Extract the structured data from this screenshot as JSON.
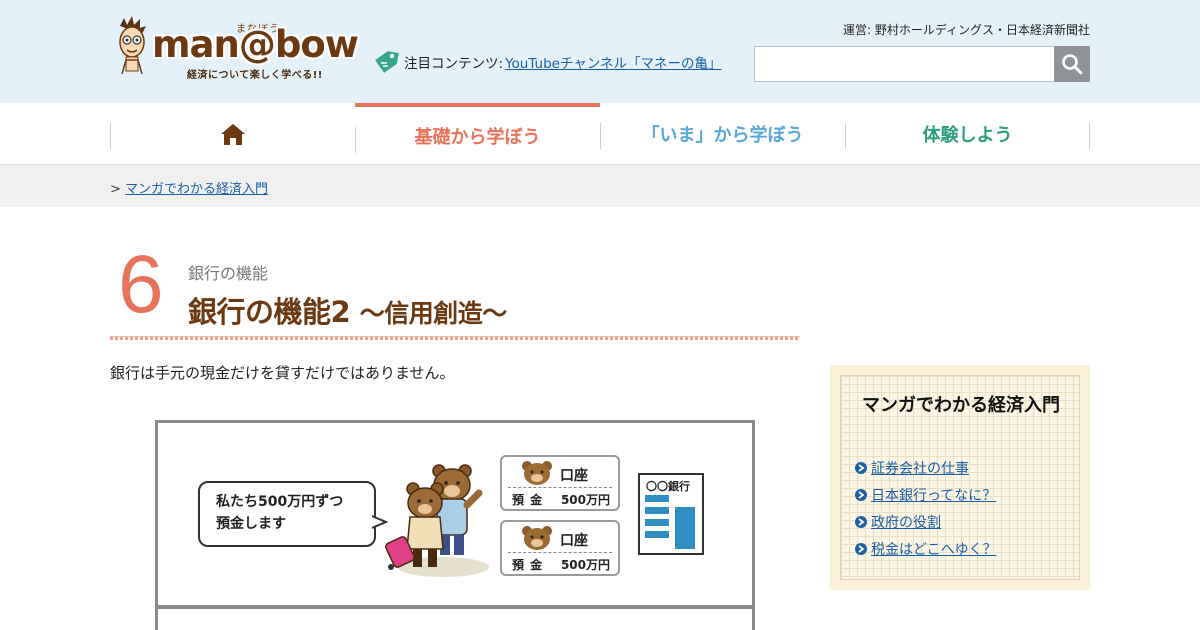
{
  "header": {
    "logo_ruby": "まなぼう",
    "logo_word": "man@bow",
    "logo_tagline": "経済について楽しく学べる!!",
    "operator": "運営: 野村ホールディングス・日本経済新聞社",
    "featured_label": "注目コンテンツ:",
    "featured_link": "YouTubeチャンネル「マネーの亀」",
    "search_placeholder": ""
  },
  "nav": {
    "items": [
      {
        "label": "",
        "icon": "home-icon"
      },
      {
        "label": "基礎から学ぼう",
        "active": true
      },
      {
        "label": "「いま」から学ぼう"
      },
      {
        "label": "体験しよう"
      }
    ]
  },
  "breadcrumb": {
    "separator": ">",
    "link": "マンガでわかる経済入門"
  },
  "article": {
    "chapter_number": "6",
    "subtitle": "銀行の機能",
    "title_main": "銀行の機能2",
    "title_sub": "〜信用創造〜",
    "lead": "銀行は手元の現金だけを貸すだけではありません。"
  },
  "manga": {
    "speech_line1": "私たち500万円ずつ",
    "speech_line2": "預金します",
    "accounts": [
      {
        "label": "口座",
        "deposit": "預 金",
        "amount": "500万円"
      },
      {
        "label": "口座",
        "deposit": "預 金",
        "amount": "500万円"
      }
    ],
    "bank_name": "〇〇銀行"
  },
  "sidebar": {
    "title": "マンガでわかる経済入門",
    "links": [
      "証券会社の仕事",
      "日本銀行ってなに？",
      "政府の役割",
      "税金はどこへゆく？"
    ]
  },
  "colors": {
    "header_bg": "#e5f1f8",
    "accent_basic": "#e8735c",
    "accent_now": "#5aa7d9",
    "accent_experience": "#2e9f7e",
    "title_brown": "#6b3a12",
    "sidebar_bg": "#fbf1d8"
  }
}
